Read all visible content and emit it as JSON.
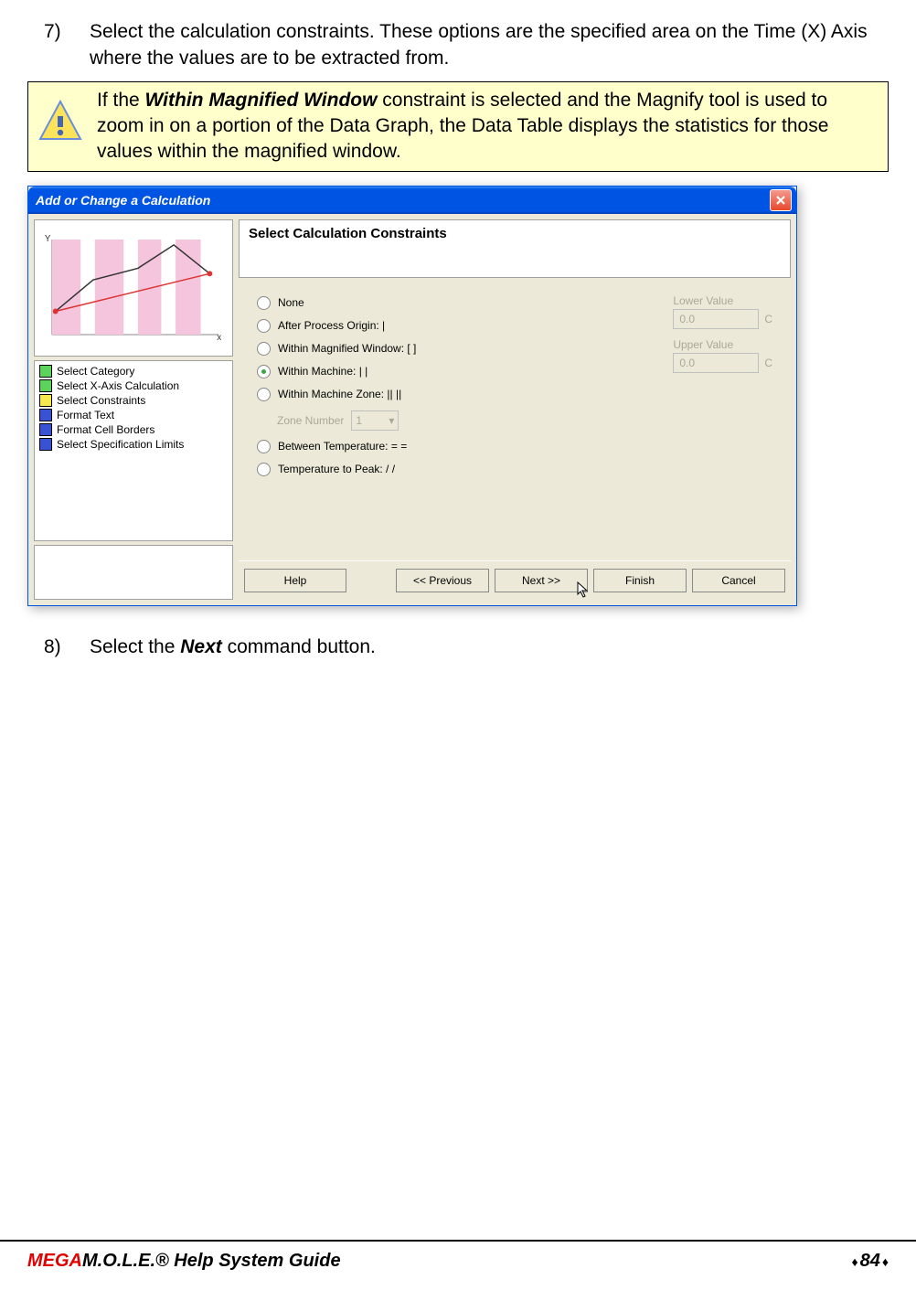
{
  "step7": {
    "number": "7)",
    "text": "Select the calculation constraints. These options are the specified area on the Time (X) Axis where the values are to be extracted from."
  },
  "note": {
    "prefix": "If the ",
    "bold": "Within Magnified Window",
    "suffix": " constraint is selected and the Magnify tool is used to zoom in on a portion of the Data Graph, the Data Table displays the statistics for those values within the magnified window."
  },
  "dialog": {
    "title": "Add or Change a Calculation",
    "right_title": "Select Calculation Constraints",
    "graph": {
      "y_label": "Y",
      "x_label": "x"
    },
    "steps": [
      {
        "color": "#5dd35d",
        "label": "Select Category"
      },
      {
        "color": "#5dd35d",
        "label": "Select X-Axis Calculation"
      },
      {
        "color": "#f5e94f",
        "label": "Select Constraints"
      },
      {
        "color": "#3952d4",
        "label": "Format Text"
      },
      {
        "color": "#3952d4",
        "label": "Format Cell Borders"
      },
      {
        "color": "#3952d4",
        "label": "Select Specification Limits"
      }
    ],
    "radios": {
      "none": "None",
      "after_origin": "After Process Origin: |",
      "within_magnified": "Within Magnified Window: [  ]",
      "within_machine": "Within Machine: |  |",
      "within_zone": "Within Machine Zone: ||  ||",
      "zone_number_label": "Zone Number",
      "zone_number_value": "1",
      "between_temp": "Between Temperature: =  =",
      "temp_to_peak": "Temperature to Peak: /  /"
    },
    "values": {
      "lower_label": "Lower Value",
      "lower_value": "0.0",
      "lower_unit": "C",
      "upper_label": "Upper Value",
      "upper_value": "0.0",
      "upper_unit": "C"
    },
    "buttons": {
      "help": "Help",
      "previous": "<< Previous",
      "next": "Next >>",
      "finish": "Finish",
      "cancel": "Cancel"
    }
  },
  "step8": {
    "number": "8)",
    "prefix": "Select the ",
    "bold": "Next",
    "suffix": " command button."
  },
  "footer": {
    "mega": "MEGA",
    "rest": "M.O.L.E.® Help System Guide",
    "page": "84"
  }
}
